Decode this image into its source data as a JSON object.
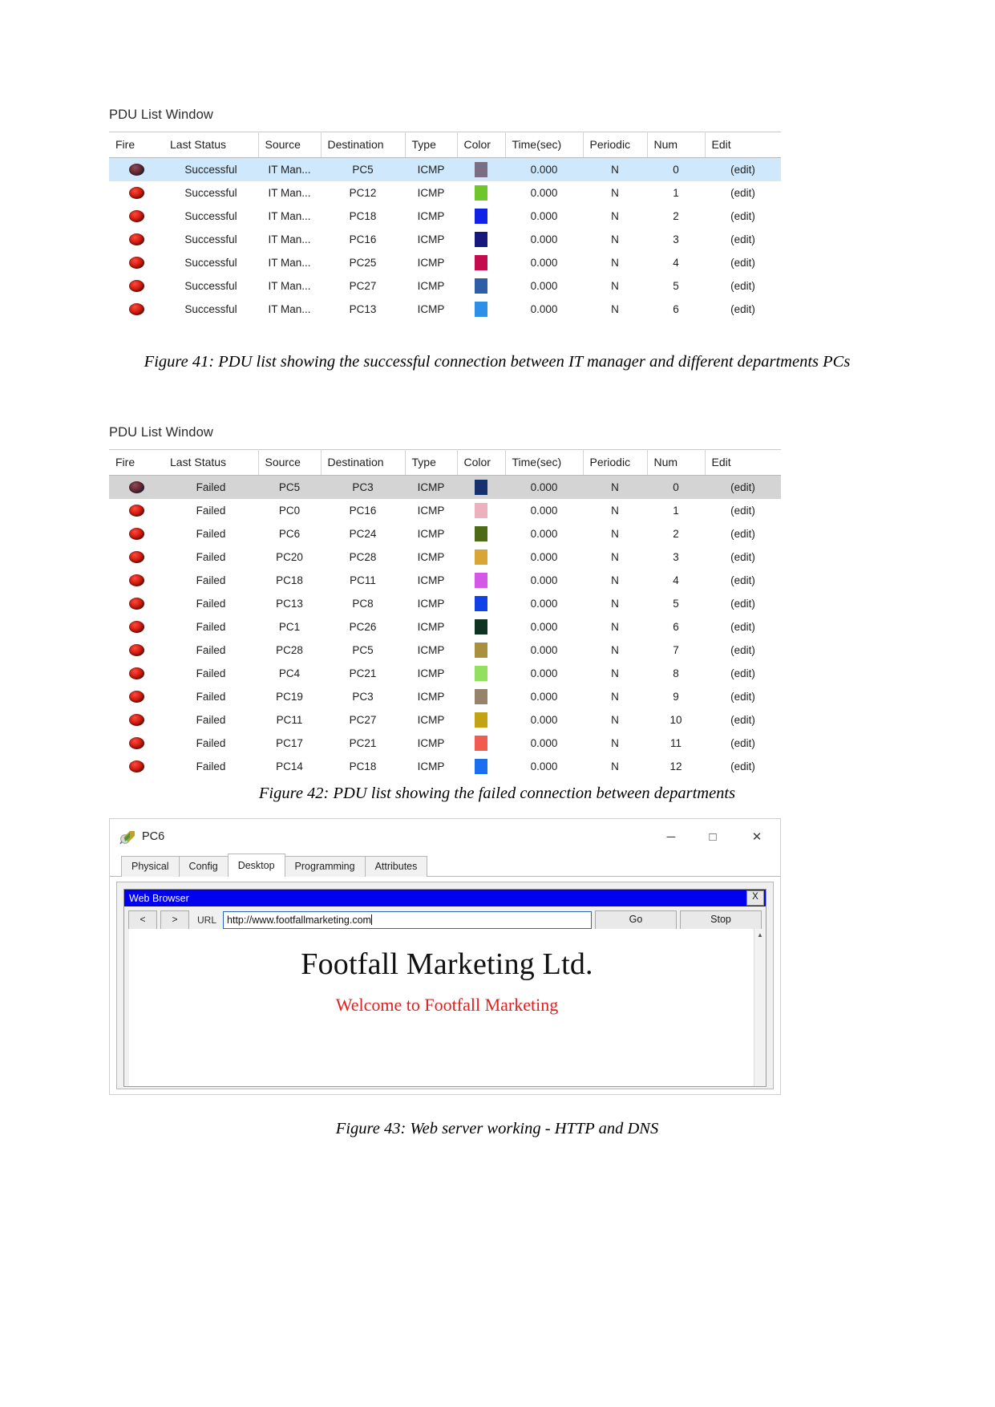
{
  "figure41": {
    "window_title": "PDU List Window",
    "columns": [
      "Fire",
      "Last Status",
      "Source",
      "Destination",
      "Type",
      "Color",
      "Time(sec)",
      "Periodic",
      "Num",
      "Edit"
    ],
    "rows": [
      {
        "fire": "led",
        "status": "Successful",
        "source": "IT Man...",
        "destination": "PC5",
        "type": "ICMP",
        "color": "#7b6e84",
        "time": "0.000",
        "periodic": "N",
        "num": "0",
        "edit": "(edit)",
        "selected": true
      },
      {
        "fire": "led",
        "status": "Successful",
        "source": "IT Man...",
        "destination": "PC12",
        "type": "ICMP",
        "color": "#6dc72b",
        "time": "0.000",
        "periodic": "N",
        "num": "1",
        "edit": "(edit)",
        "selected": false
      },
      {
        "fire": "led",
        "status": "Successful",
        "source": "IT Man...",
        "destination": "PC18",
        "type": "ICMP",
        "color": "#1122e8",
        "time": "0.000",
        "periodic": "N",
        "num": "2",
        "edit": "(edit)",
        "selected": false
      },
      {
        "fire": "led",
        "status": "Successful",
        "source": "IT Man...",
        "destination": "PC16",
        "type": "ICMP",
        "color": "#16187e",
        "time": "0.000",
        "periodic": "N",
        "num": "3",
        "edit": "(edit)",
        "selected": false
      },
      {
        "fire": "led",
        "status": "Successful",
        "source": "IT Man...",
        "destination": "PC25",
        "type": "ICMP",
        "color": "#c30b4e",
        "time": "0.000",
        "periodic": "N",
        "num": "4",
        "edit": "(edit)",
        "selected": false
      },
      {
        "fire": "led",
        "status": "Successful",
        "source": "IT Man...",
        "destination": "PC27",
        "type": "ICMP",
        "color": "#2f5ea8",
        "time": "0.000",
        "periodic": "N",
        "num": "5",
        "edit": "(edit)",
        "selected": false
      },
      {
        "fire": "led",
        "status": "Successful",
        "source": "IT Man...",
        "destination": "PC13",
        "type": "ICMP",
        "color": "#2e8fe8",
        "time": "0.000",
        "periodic": "N",
        "num": "6",
        "edit": "(edit)",
        "selected": false
      }
    ],
    "caption": "Figure 41: PDU list showing the successful connection between IT manager and different departments PCs"
  },
  "figure42": {
    "window_title": "PDU List Window",
    "columns": [
      "Fire",
      "Last Status",
      "Source",
      "Destination",
      "Type",
      "Color",
      "Time(sec)",
      "Periodic",
      "Num",
      "Edit"
    ],
    "rows": [
      {
        "fire": "led",
        "status": "Failed",
        "source": "PC5",
        "destination": "PC3",
        "type": "ICMP",
        "color": "#16306e",
        "time": "0.000",
        "periodic": "N",
        "num": "0",
        "edit": "(edit)",
        "selected": true
      },
      {
        "fire": "led",
        "status": "Failed",
        "source": "PC0",
        "destination": "PC16",
        "type": "ICMP",
        "color": "#edb0bd",
        "time": "0.000",
        "periodic": "N",
        "num": "1",
        "edit": "(edit)",
        "selected": false
      },
      {
        "fire": "led",
        "status": "Failed",
        "source": "PC6",
        "destination": "PC24",
        "type": "ICMP",
        "color": "#4f6a16",
        "time": "0.000",
        "periodic": "N",
        "num": "2",
        "edit": "(edit)",
        "selected": false
      },
      {
        "fire": "led",
        "status": "Failed",
        "source": "PC20",
        "destination": "PC28",
        "type": "ICMP",
        "color": "#d9a636",
        "time": "0.000",
        "periodic": "N",
        "num": "3",
        "edit": "(edit)",
        "selected": false
      },
      {
        "fire": "led",
        "status": "Failed",
        "source": "PC18",
        "destination": "PC11",
        "type": "ICMP",
        "color": "#d458e8",
        "time": "0.000",
        "periodic": "N",
        "num": "4",
        "edit": "(edit)",
        "selected": false
      },
      {
        "fire": "led",
        "status": "Failed",
        "source": "PC13",
        "destination": "PC8",
        "type": "ICMP",
        "color": "#1040e8",
        "time": "0.000",
        "periodic": "N",
        "num": "5",
        "edit": "(edit)",
        "selected": false
      },
      {
        "fire": "led",
        "status": "Failed",
        "source": "PC1",
        "destination": "PC26",
        "type": "ICMP",
        "color": "#0e3320",
        "time": "0.000",
        "periodic": "N",
        "num": "6",
        "edit": "(edit)",
        "selected": false
      },
      {
        "fire": "led",
        "status": "Failed",
        "source": "PC28",
        "destination": "PC5",
        "type": "ICMP",
        "color": "#a8903d",
        "time": "0.000",
        "periodic": "N",
        "num": "7",
        "edit": "(edit)",
        "selected": false
      },
      {
        "fire": "led",
        "status": "Failed",
        "source": "PC4",
        "destination": "PC21",
        "type": "ICMP",
        "color": "#93e061",
        "time": "0.000",
        "periodic": "N",
        "num": "8",
        "edit": "(edit)",
        "selected": false
      },
      {
        "fire": "led",
        "status": "Failed",
        "source": "PC19",
        "destination": "PC3",
        "type": "ICMP",
        "color": "#96836a",
        "time": "0.000",
        "periodic": "N",
        "num": "9",
        "edit": "(edit)",
        "selected": false
      },
      {
        "fire": "led",
        "status": "Failed",
        "source": "PC11",
        "destination": "PC27",
        "type": "ICMP",
        "color": "#c3a213",
        "time": "0.000",
        "periodic": "N",
        "num": "10",
        "edit": "(edit)",
        "selected": false
      },
      {
        "fire": "led",
        "status": "Failed",
        "source": "PC17",
        "destination": "PC21",
        "type": "ICMP",
        "color": "#f25c50",
        "time": "0.000",
        "periodic": "N",
        "num": "11",
        "edit": "(edit)",
        "selected": false
      },
      {
        "fire": "led",
        "status": "Failed",
        "source": "PC14",
        "destination": "PC18",
        "type": "ICMP",
        "color": "#1a6ef0",
        "time": "0.000",
        "periodic": "N",
        "num": "12",
        "edit": "(edit)",
        "selected": false
      }
    ],
    "caption": "Figure 42: PDU list showing the failed connection between departments"
  },
  "figure43": {
    "window": {
      "title": "PC6",
      "minimize": "─",
      "maximize": "□",
      "close": "✕"
    },
    "tabs": [
      {
        "label": "Physical",
        "active": false
      },
      {
        "label": "Config",
        "active": false
      },
      {
        "label": "Desktop",
        "active": true
      },
      {
        "label": "Programming",
        "active": false
      },
      {
        "label": "Attributes",
        "active": false
      }
    ],
    "browser": {
      "title": "Web Browser",
      "close_label": "X",
      "back_label": "<",
      "forward_label": ">",
      "url_label": "URL",
      "url_value": "http://www.footfallmarketing.com",
      "go_label": "Go",
      "stop_label": "Stop",
      "scroll_up_glyph": "▲"
    },
    "page_content": {
      "heading": "Footfall Marketing Ltd.",
      "subheading": "Welcome to Footfall Marketing"
    },
    "caption": "Figure 43: Web server working - HTTP and DNS"
  }
}
